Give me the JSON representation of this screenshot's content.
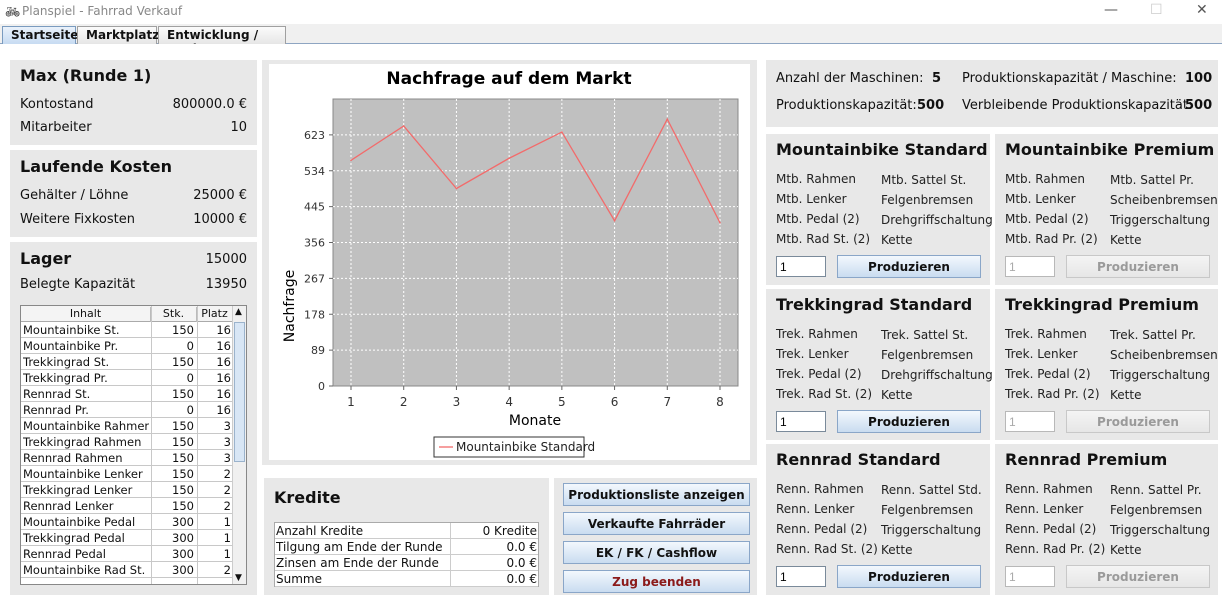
{
  "window": {
    "title": "Planspiel - Fahrrad Verkauf",
    "minimize": "—",
    "maximize": "☐",
    "close": "✕"
  },
  "tabs": [
    "Startseite",
    "Marktplatz",
    "Entwicklung / Bank"
  ],
  "player": {
    "title": "Max (Runde 1)",
    "kontostand_label": "Kontostand",
    "kontostand_value": "800000.0 €",
    "mitarbeiter_label": "Mitarbeiter",
    "mitarbeiter_value": "10"
  },
  "kosten": {
    "title": "Laufende Kosten",
    "gehalt_label": "Gehälter / Löhne",
    "gehalt_value": "25000 €",
    "fix_label": "Weitere Fixkosten",
    "fix_value": "10000 €"
  },
  "lager": {
    "title": "Lager",
    "value": "15000",
    "kap_label": "Belegte Kapazität",
    "kap_value": "13950",
    "columns": [
      "Inhalt",
      "Stk.",
      "Platz"
    ],
    "rows": [
      [
        "Mountainbike St.",
        "150",
        "16"
      ],
      [
        "Mountainbike Pr.",
        "0",
        "16"
      ],
      [
        "Trekkingrad St.",
        "150",
        "16"
      ],
      [
        "Trekkingrad Pr.",
        "0",
        "16"
      ],
      [
        "Rennrad St.",
        "150",
        "16"
      ],
      [
        "Rennrad Pr.",
        "0",
        "16"
      ],
      [
        "Mountainbike Rahmen",
        "150",
        "3"
      ],
      [
        "Trekkingrad Rahmen",
        "150",
        "3"
      ],
      [
        "Rennrad Rahmen",
        "150",
        "3"
      ],
      [
        "Mountainbike Lenker",
        "150",
        "2"
      ],
      [
        "Trekkingrad Lenker",
        "150",
        "2"
      ],
      [
        "Rennrad Lenker",
        "150",
        "2"
      ],
      [
        "Mountainbike Pedal",
        "300",
        "1"
      ],
      [
        "Trekkingrad Pedal",
        "300",
        "1"
      ],
      [
        "Rennrad Pedal",
        "300",
        "1"
      ],
      [
        "Mountainbike Rad St.",
        "300",
        "2"
      ]
    ]
  },
  "chart_data": {
    "type": "line",
    "title": "Nachfrage auf dem Markt",
    "xlabel": "Monate",
    "ylabel": "Nachfrage",
    "x": [
      1,
      2,
      3,
      4,
      5,
      6,
      7,
      8
    ],
    "xticks": [
      "1",
      "2",
      "3",
      "4",
      "5",
      "6",
      "7",
      "8"
    ],
    "yticks": [
      "0",
      "89",
      "178",
      "267",
      "356",
      "445",
      "534",
      "623"
    ],
    "ylim": [
      0,
      712
    ],
    "series": [
      {
        "name": "Mountainbike Standard",
        "values": [
          560,
          645,
          490,
          565,
          630,
          410,
          662,
          405
        ]
      }
    ],
    "grid": true,
    "legend": "bottom"
  },
  "kredite": {
    "title": "Kredite",
    "rows": [
      [
        "Anzahl Kredite",
        "0 Kredite"
      ],
      [
        "Tilgung am Ende der Runde",
        "0.0 €"
      ],
      [
        "Zinsen am Ende der Runde",
        "0.0 €"
      ],
      [
        "Summe",
        "0.0 €"
      ]
    ]
  },
  "actions": {
    "prodliste": "Produktionsliste anzeigen",
    "verkauft": "Verkaufte Fahrräder",
    "ekfk": "EK / FK / Cashflow",
    "zug": "Zug beenden"
  },
  "maschinen": {
    "anzahl_label": "Anzahl der Maschinen:",
    "anzahl_value": "5",
    "kap_label": "Produktionskapazität:",
    "kap_value": "500",
    "kapm_label": "Produktionskapazität / Maschine:",
    "kapm_value": "100",
    "rest_label": "Verbleibende Produktionskapazität:",
    "rest_value": "500"
  },
  "produkte": [
    {
      "title": "Mountainbike Standard",
      "parts": [
        "Mtb. Rahmen",
        "Mtb. Lenker",
        "Mtb. Pedal (2)",
        "Mtb. Rad St. (2)",
        "Mtb. Sattel St.",
        "Felgenbremsen",
        "Drehgriffschaltung",
        "Kette"
      ],
      "qty": "1",
      "button": "Produzieren"
    },
    {
      "title": "Mountainbike Premium",
      "parts": [
        "Mtb. Rahmen",
        "Mtb. Lenker",
        "Mtb. Pedal (2)",
        "Mtb. Rad Pr. (2)",
        "Mtb. Sattel Pr.",
        "Scheibenbremsen",
        "Triggerschaltung",
        "Kette"
      ],
      "qty": "1",
      "button": "Produzieren"
    },
    {
      "title": "Trekkingrad Standard",
      "parts": [
        "Trek. Rahmen",
        "Trek. Lenker",
        "Trek. Pedal (2)",
        "Trek. Rad St. (2)",
        "Trek. Sattel St.",
        "Felgenbremsen",
        "Drehgriffschaltung",
        "Kette"
      ],
      "qty": "1",
      "button": "Produzieren"
    },
    {
      "title": "Trekkingrad Premium",
      "parts": [
        "Trek. Rahmen",
        "Trek. Lenker",
        "Trek. Pedal (2)",
        "Trek. Rad Pr. (2)",
        "Trek. Sattel Pr.",
        "Scheibenbremsen",
        "Triggerschaltung",
        "Kette"
      ],
      "qty": "1",
      "button": "Produzieren"
    },
    {
      "title": "Rennrad Standard",
      "parts": [
        "Renn. Rahmen",
        "Renn. Lenker",
        "Renn. Pedal (2)",
        "Renn. Rad St. (2)",
        "Renn. Sattel Std.",
        "Felgenbremsen",
        "Triggerschaltung",
        "Kette"
      ],
      "qty": "1",
      "button": "Produzieren"
    },
    {
      "title": "Rennrad Premium",
      "parts": [
        "Renn. Rahmen",
        "Renn. Lenker",
        "Renn. Pedal (2)",
        "Renn. Rad Pr. (2)",
        "Renn. Sattel Pr.",
        "Felgenbremsen",
        "Triggerschaltung",
        "Kette"
      ],
      "qty": "1",
      "button": "Produzieren"
    }
  ]
}
